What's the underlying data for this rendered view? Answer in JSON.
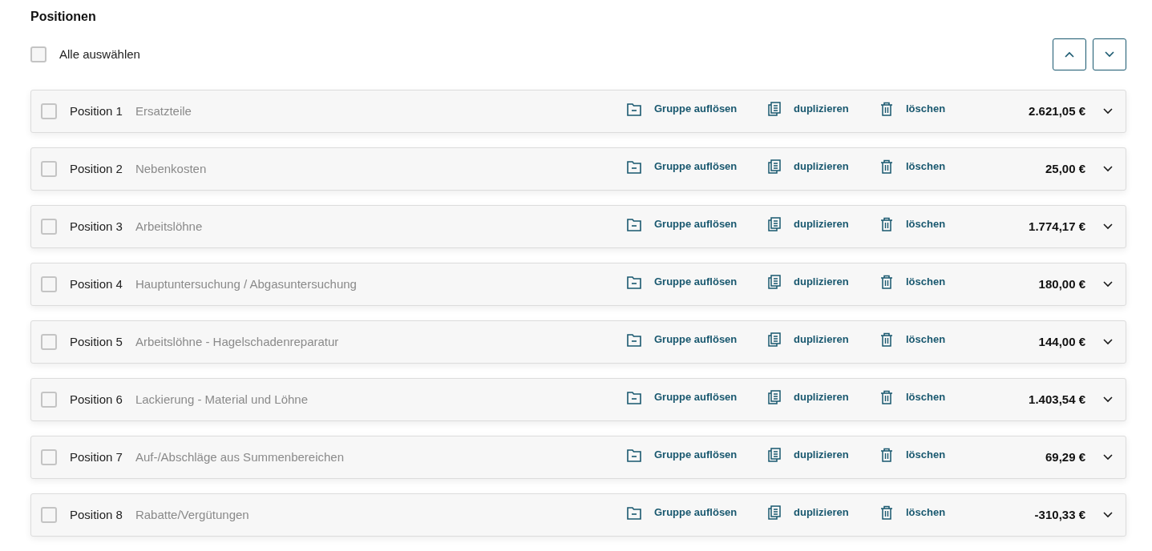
{
  "heading": "Positionen",
  "select_all": {
    "label": "Alle auswählen",
    "checked": false
  },
  "positions": [
    {
      "label": "Position 1",
      "title": "Ersatzteile",
      "actions": [
        {
          "kind": "ungroup",
          "label": "Gruppe auflösen"
        },
        {
          "kind": "duplicate",
          "label": "duplizieren"
        },
        {
          "kind": "delete",
          "label": "löschen"
        }
      ],
      "amount": "2.621,05 €",
      "checked": false,
      "expanded": false
    },
    {
      "label": "Position 2",
      "title": "Nebenkosten",
      "actions": [
        {
          "kind": "ungroup",
          "label": "Gruppe auflösen"
        },
        {
          "kind": "duplicate",
          "label": "duplizieren"
        },
        {
          "kind": "delete",
          "label": "löschen"
        }
      ],
      "amount": "25,00 €",
      "checked": false,
      "expanded": false
    },
    {
      "label": "Position 3",
      "title": "Arbeitslöhne",
      "actions": [
        {
          "kind": "ungroup",
          "label": "Gruppe auflösen"
        },
        {
          "kind": "duplicate",
          "label": "duplizieren"
        },
        {
          "kind": "delete",
          "label": "löschen"
        }
      ],
      "amount": "1.774,17 €",
      "checked": false,
      "expanded": false
    },
    {
      "label": "Position 4",
      "title": "Hauptuntersuchung / Abgasuntersuchung",
      "actions": [
        {
          "kind": "ungroup",
          "label": "Gruppe auflösen"
        },
        {
          "kind": "duplicate",
          "label": "duplizieren"
        },
        {
          "kind": "delete",
          "label": "löschen"
        }
      ],
      "amount": "180,00 €",
      "checked": false,
      "expanded": false
    },
    {
      "label": "Position 5",
      "title": "Arbeitslöhne - Hagelschadenreparatur",
      "actions": [
        {
          "kind": "ungroup",
          "label": "Gruppe auflösen"
        },
        {
          "kind": "duplicate",
          "label": "duplizieren"
        },
        {
          "kind": "delete",
          "label": "löschen"
        }
      ],
      "amount": "144,00 €",
      "checked": false,
      "expanded": false
    },
    {
      "label": "Position 6",
      "title": "Lackierung - Material und Löhne",
      "actions": [
        {
          "kind": "ungroup",
          "label": "Gruppe auflösen"
        },
        {
          "kind": "duplicate",
          "label": "duplizieren"
        },
        {
          "kind": "delete",
          "label": "löschen"
        }
      ],
      "amount": "1.403,54 €",
      "checked": false,
      "expanded": false
    },
    {
      "label": "Position 7",
      "title": "Auf-/Abschläge aus Summenbereichen",
      "actions": [
        {
          "kind": "ungroup",
          "label": "Gruppe auflösen"
        },
        {
          "kind": "duplicate",
          "label": "duplizieren"
        },
        {
          "kind": "delete",
          "label": "löschen"
        }
      ],
      "amount": "69,29 €",
      "checked": false,
      "expanded": false
    },
    {
      "label": "Position 8",
      "title": "Rabatte/Vergütungen",
      "actions": [
        {
          "kind": "ungroup",
          "label": "Gruppe auflösen"
        },
        {
          "kind": "duplicate",
          "label": "duplizieren"
        },
        {
          "kind": "delete",
          "label": "löschen"
        }
      ],
      "amount": "-310,33 €",
      "checked": false,
      "expanded": false
    }
  ]
}
